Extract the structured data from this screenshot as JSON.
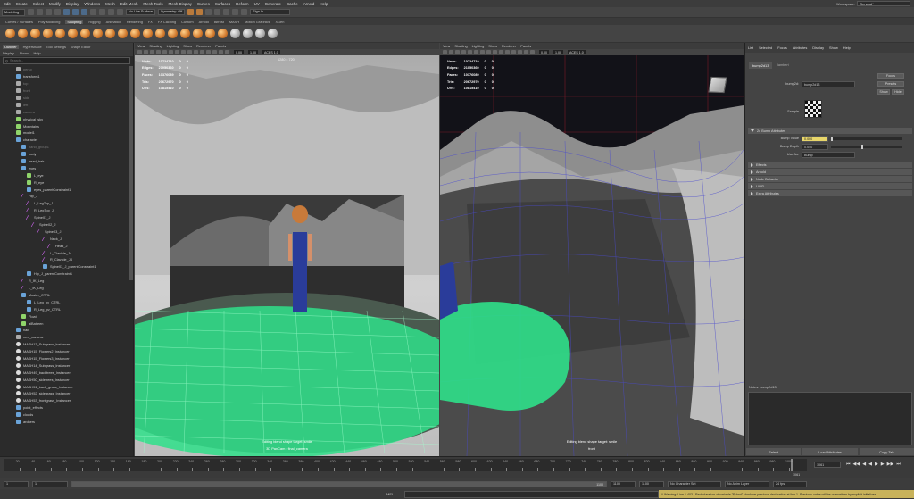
{
  "menubar": {
    "items": [
      "Edit",
      "Create",
      "Select",
      "Modify",
      "Display",
      "Windows",
      "Mesh",
      "Edit Mesh",
      "Mesh Tools",
      "Mesh Display",
      "Curves",
      "Surfaces",
      "Deform",
      "UV",
      "Generate",
      "Cache",
      "Arnold",
      "Help"
    ],
    "workspace_label": "Workspace:",
    "workspace_value": "General*"
  },
  "statusline": {
    "mode": "Modeling",
    "live_surface": "No Live Surface",
    "symmetry": "Symmetry: Off",
    "sign_in": "Sign In"
  },
  "shelf": {
    "tabs": [
      "Curves / Surfaces",
      "Poly Modeling",
      "Sculpting",
      "Rigging",
      "Animation",
      "Rendering",
      "FX",
      "FX Caching",
      "Custom",
      "Arnold",
      "Bifrost",
      "MASH",
      "Motion Graphics",
      "XGen"
    ],
    "active_tab": "Sculpting"
  },
  "outliner": {
    "tabs": [
      "Outliner",
      "Hypershade",
      "Tool Settings",
      "Shape Editor"
    ],
    "menu": [
      "Display",
      "Show",
      "Help"
    ],
    "search_placeholder": "Search...",
    "items": [
      {
        "label": "persp",
        "indent": 4,
        "kind": "c",
        "dim": true
      },
      {
        "label": "transform1",
        "indent": 4,
        "kind": "gr",
        "dim": false
      },
      {
        "label": "top",
        "indent": 4,
        "kind": "c",
        "dim": true
      },
      {
        "label": "front",
        "indent": 4,
        "kind": "c",
        "dim": true
      },
      {
        "label": "side",
        "indent": 4,
        "kind": "c",
        "dim": true
      },
      {
        "label": "left",
        "indent": 4,
        "kind": "c",
        "dim": true
      },
      {
        "label": "camera",
        "indent": 4,
        "kind": "c",
        "dim": true
      },
      {
        "label": "physical_sky",
        "indent": 4,
        "kind": "sh",
        "dim": false
      },
      {
        "label": "Mountains",
        "indent": 4,
        "kind": "sh",
        "dim": false
      },
      {
        "label": "model1",
        "indent": 4,
        "kind": "sh",
        "dim": false
      },
      {
        "label": "character",
        "indent": 4,
        "kind": "gr",
        "dim": false
      },
      {
        "label": "hand_group1",
        "indent": 10,
        "kind": "gr",
        "dim": true
      },
      {
        "label": "body",
        "indent": 10,
        "kind": "gr",
        "dim": false
      },
      {
        "label": "head_hair",
        "indent": 10,
        "kind": "gr",
        "dim": false
      },
      {
        "label": "eyes",
        "indent": 10,
        "kind": "gr",
        "dim": false
      },
      {
        "label": "L_eye",
        "indent": 16,
        "kind": "sh",
        "dim": false
      },
      {
        "label": "R_eye",
        "indent": 16,
        "kind": "sh",
        "dim": false
      },
      {
        "label": "eyes_parentConstraint1",
        "indent": 16,
        "kind": "gr",
        "dim": false
      },
      {
        "label": "Hip_J",
        "indent": 10,
        "kind": "j",
        "dim": false
      },
      {
        "label": "L_LegTop_J",
        "indent": 16,
        "kind": "j",
        "dim": false
      },
      {
        "label": "R_LegTop_J",
        "indent": 16,
        "kind": "j",
        "dim": false
      },
      {
        "label": "Spine01_J",
        "indent": 16,
        "kind": "j",
        "dim": false
      },
      {
        "label": "Spine02_J",
        "indent": 22,
        "kind": "j",
        "dim": false
      },
      {
        "label": "Spine03_J",
        "indent": 28,
        "kind": "j",
        "dim": false
      },
      {
        "label": "Neck_J",
        "indent": 34,
        "kind": "j",
        "dim": false
      },
      {
        "label": "Head_J",
        "indent": 40,
        "kind": "j",
        "dim": false
      },
      {
        "label": "L_Clavicle_J4",
        "indent": 34,
        "kind": "j",
        "dim": false
      },
      {
        "label": "R_Clavicle_J4",
        "indent": 34,
        "kind": "j",
        "dim": false
      },
      {
        "label": "Spine03_J_parentConstraint1",
        "indent": 34,
        "kind": "gr",
        "dim": false
      },
      {
        "label": "Hip_J_parentConstraint1",
        "indent": 16,
        "kind": "gr",
        "dim": false
      },
      {
        "label": "R_IK_Leg",
        "indent": 10,
        "kind": "j",
        "dim": false
      },
      {
        "label": "L_IK_Leg",
        "indent": 10,
        "kind": "j",
        "dim": false
      },
      {
        "label": "Master_CTRL",
        "indent": 10,
        "kind": "gr",
        "dim": false
      },
      {
        "label": "L_Leg_pv_CTRL",
        "indent": 16,
        "kind": "gr",
        "dim": false
      },
      {
        "label": "R_Leg_pv_CTRL",
        "indent": 16,
        "kind": "gr",
        "dim": false
      },
      {
        "label": "Float",
        "indent": 10,
        "kind": "sh",
        "dim": false
      },
      {
        "label": "aiBatteen",
        "indent": 10,
        "kind": "sh",
        "dim": false
      },
      {
        "label": "hair",
        "indent": 4,
        "kind": "gr",
        "dim": false
      },
      {
        "label": "new_camera",
        "indent": 4,
        "kind": "c",
        "dim": false
      },
      {
        "label": "MASH13_Subgrass_Instancer",
        "indent": 4,
        "kind": "mash",
        "dim": false
      },
      {
        "label": "MASH15_Flowers2_Instancer",
        "indent": 4,
        "kind": "mash",
        "dim": false
      },
      {
        "label": "MASH15_Flowers3_Instancer",
        "indent": 4,
        "kind": "mash",
        "dim": false
      },
      {
        "label": "MASH14_Subgrass_Instancer",
        "indent": 4,
        "kind": "mash",
        "dim": false
      },
      {
        "label": "MASH49_backtrees_Instancer",
        "indent": 4,
        "kind": "mash",
        "dim": false
      },
      {
        "label": "MASH50_sidetrees_Instancer",
        "indent": 4,
        "kind": "mash",
        "dim": false
      },
      {
        "label": "MASH51_back_grass_Instancer",
        "indent": 4,
        "kind": "mash",
        "dim": false
      },
      {
        "label": "MASH52_sidegrass_Instancer",
        "indent": 4,
        "kind": "mash",
        "dim": false
      },
      {
        "label": "MASH53_frontgrass_Instancer",
        "indent": 4,
        "kind": "mash",
        "dim": false
      },
      {
        "label": "point_effects",
        "indent": 4,
        "kind": "gr",
        "dim": false
      },
      {
        "label": "clouds",
        "indent": 4,
        "kind": "gr",
        "dim": false
      },
      {
        "label": "archers",
        "indent": 4,
        "kind": "gr",
        "dim": false
      }
    ]
  },
  "viewport_left": {
    "menu": [
      "View",
      "Shading",
      "Lighting",
      "Show",
      "Renderer",
      "Panels"
    ],
    "hud": [
      {
        "label": "Verts:",
        "a": "10724710",
        "b": "0",
        "c": "0"
      },
      {
        "label": "Edges:",
        "a": "21050360",
        "b": "0",
        "c": "0"
      },
      {
        "label": "Faces:",
        "a": "10376089",
        "b": "0",
        "c": "0"
      },
      {
        "label": "Tris:",
        "a": "20672970",
        "b": "0",
        "c": "0"
      },
      {
        "label": "UVs:",
        "a": "10815410",
        "b": "0",
        "c": "0"
      }
    ],
    "resolution": "1280 x 720",
    "blend_text": "Editing blend shape target: smile",
    "camera_label": "3D PanCam : final_camera",
    "val1": "0.00",
    "val2": "1.00",
    "color_space": "ACES 1.0"
  },
  "viewport_right": {
    "menu": [
      "View",
      "Shading",
      "Lighting",
      "Show",
      "Renderer",
      "Panels"
    ],
    "hud": [
      {
        "label": "Verts:",
        "a": "10724710",
        "b": "0",
        "c": "0"
      },
      {
        "label": "Edges:",
        "a": "21050360",
        "b": "0",
        "c": "0"
      },
      {
        "label": "Faces:",
        "a": "10376089",
        "b": "0",
        "c": "0"
      },
      {
        "label": "Tris:",
        "a": "20672970",
        "b": "0",
        "c": "0"
      },
      {
        "label": "UVs:",
        "a": "10815410",
        "b": "0",
        "c": "0"
      }
    ],
    "blend_text": "Editing blend shape target: smile",
    "camera_label": "front",
    "val1": "0.00",
    "val2": "1.00",
    "color_space": "ACES 1.0"
  },
  "attr": {
    "menu": [
      "List",
      "Selected",
      "Focus",
      "Attributes",
      "Display",
      "Show",
      "Help"
    ],
    "node_tab": "bump2d13",
    "node_sub": "lambert",
    "type_label": "bump2d:",
    "node_name": "bump2d13",
    "focus_btn": "Focus",
    "presets_btn": "Presets",
    "show_btn": "Show",
    "hide_btn": "Hide",
    "sample_label": "Sample",
    "section_2d": "2d Bump Attributes",
    "bump_value_label": "Bump Value",
    "bump_value": "0.000",
    "bump_depth_label": "Bump Depth",
    "bump_depth": "0.040",
    "use_as_label": "Use As:",
    "use_as": "Bump",
    "sections": [
      "Effects",
      "Arnold",
      "Node Behavior",
      "UUID",
      "Extra Attributes"
    ],
    "notes_label": "Notes: bump2d13",
    "buttons": [
      "Select",
      "Load Attributes",
      "Copy Tab"
    ]
  },
  "timeline": {
    "ticks": [
      "20",
      "40",
      "60",
      "80",
      "100",
      "120",
      "140",
      "160",
      "180",
      "200",
      "220",
      "240",
      "260",
      "280",
      "300",
      "320",
      "340",
      "360",
      "380",
      "400",
      "420",
      "440",
      "460",
      "480",
      "500",
      "520",
      "540",
      "560",
      "580",
      "600",
      "620",
      "640",
      "660",
      "680",
      "700",
      "720",
      "740",
      "760",
      "780",
      "800",
      "820",
      "840",
      "860",
      "880",
      "900",
      "920",
      "940",
      "960",
      "980",
      "1000"
    ],
    "current_frame": "1061",
    "frame_field": "1061"
  },
  "range": {
    "start": "1",
    "start2": "1",
    "slider_val": "1100",
    "end": "1100",
    "end2": "1100",
    "no_char": "No Character Set",
    "no_anim": "No Anim Layer",
    "fps": "24 fps"
  },
  "cmd": {
    "mel": "MEL",
    "warning": "// Warning: Line 1.403 : Redeclaration of variable \"$shnd\" shadows previous declaration at line 1. Previous value will be overwritten by explicit initializer."
  }
}
